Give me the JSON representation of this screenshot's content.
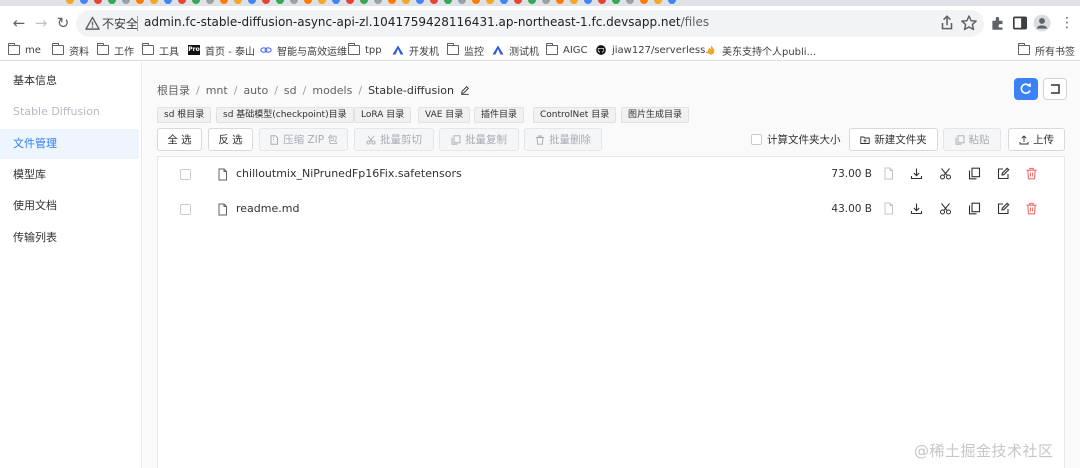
{
  "browser": {
    "insecure_label": "不安全",
    "url_host": "admin.fc-stable-diffusion-async-api-zl.1041759428116431.ap-northeast-1.fc.devsapp.net",
    "url_path": "/files",
    "bookmarks": [
      "me",
      "资料",
      "工作",
      "工具",
      "首页 - 泰山",
      "智能与高效运维",
      "tpp",
      "开发机",
      "监控",
      "测试机",
      "AIGC",
      "jiaw127/serverless...",
      "美东支持个人publi..."
    ],
    "all_bookmarks_label": "所有书签"
  },
  "sidebar": {
    "items": [
      {
        "label": "基本信息",
        "state": "normal"
      },
      {
        "label": "Stable Diffusion",
        "state": "disabled"
      },
      {
        "label": "文件管理",
        "state": "active"
      },
      {
        "label": "模型库",
        "state": "normal"
      },
      {
        "label": "使用文档",
        "state": "normal"
      },
      {
        "label": "传输列表",
        "state": "normal"
      }
    ]
  },
  "breadcrumb": {
    "segments": [
      "根目录",
      "mnt",
      "auto",
      "sd",
      "models"
    ],
    "current": "Stable-diffusion"
  },
  "quick_dirs": [
    "sd 根目录",
    "sd 基础模型(checkpoint)目录",
    "LoRA 目录",
    "VAE 目录",
    "插件目录",
    "ControlNet 目录",
    "图片生成目录"
  ],
  "toolbar": {
    "select_all": "全 选",
    "invert": "反 选",
    "zip": "压缩 ZIP 包",
    "batch_cut": "批量剪切",
    "batch_copy": "批量复制",
    "batch_delete": "批量删除",
    "calc_size": "计算文件夹大小",
    "new_folder": "新建文件夹",
    "paste": "粘贴",
    "upload": "上传"
  },
  "files": [
    {
      "name": "chilloutmix_NiPrunedFp16Fix.safetensors",
      "size": "73.00 B"
    },
    {
      "name": "readme.md",
      "size": "43.00 B"
    }
  ],
  "colors": {
    "accent": "#3b82f6",
    "danger": "#f56c6c",
    "active_bg": "#eef5fe"
  },
  "watermark": "@稀土掘金技术社区"
}
